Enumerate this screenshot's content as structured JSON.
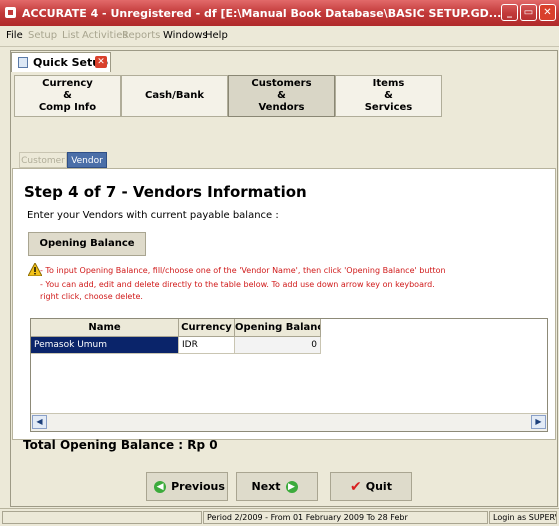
{
  "window": {
    "title": "ACCURATE 4 - Unregistered - df [E:\\Manual Book Database\\BASIC SETUP.GD...",
    "controls": [
      "minimize-icon",
      "restore-icon",
      "close-icon"
    ]
  },
  "menubar": {
    "items": [
      "File",
      "Setup",
      "List",
      "Activities",
      "Reports",
      "Windows",
      "Help"
    ]
  },
  "quick_setup_tab": {
    "label": "Quick Setup"
  },
  "step_tabs": [
    {
      "label": "Currency\n&\nComp Info",
      "active": false
    },
    {
      "label": "Cash/Bank",
      "active": false
    },
    {
      "label": "Customers\n&\nVendors",
      "active": true
    },
    {
      "label": "Items\n&\nServices",
      "active": false
    }
  ],
  "sub_tabs": {
    "customer": "Customer",
    "vendor": "Vendor"
  },
  "step": {
    "title": "Step 4 of 7   - Vendors Information",
    "subtitle": "Enter your Vendors with current payable balance :"
  },
  "opening_balance_button": "Opening Balance",
  "notes": [
    "- To input Opening Balance, fill/choose one of the 'Vendor Name', then click 'Opening Balance' button",
    "- You can add, edit and delete directly to the table below. To add use down arrow key on keyboard.",
    "  right click, choose delete."
  ],
  "table": {
    "columns": [
      "Name",
      "Currency",
      "Opening Balance"
    ],
    "rows": [
      {
        "name": "Pemasok Umum",
        "currency": "IDR",
        "opening_balance": "0"
      }
    ]
  },
  "total": "Total Opening Balance : Rp 0",
  "buttons": {
    "previous": "Previous",
    "next": "Next",
    "quit": "Quit"
  },
  "statusbar": {
    "period": "Period 2/2009 - From 01 February 2009 To 28 Febr",
    "login": "Login as SUPERV"
  },
  "colors": {
    "titlebar": "#c23a3a",
    "selected_row": "#0a246a",
    "note_text": "#d01a1a",
    "vendor_tab": "#4b6fa8"
  }
}
